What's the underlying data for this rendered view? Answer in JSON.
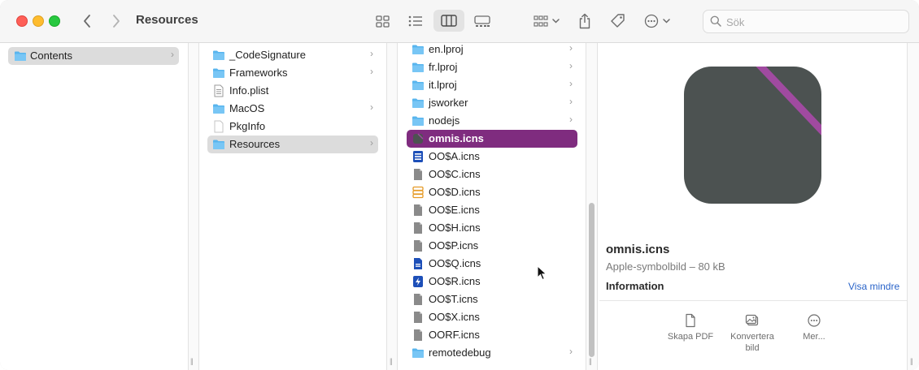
{
  "window": {
    "title": "Resources"
  },
  "toolbar": {
    "back": "back",
    "forward": "forward",
    "views": [
      "icon-view",
      "list-view",
      "column-view",
      "gallery-view"
    ],
    "group": "group",
    "share": "share",
    "tags": "tags",
    "more": "more",
    "search_placeholder": "Sök"
  },
  "columns": [
    {
      "items": [
        {
          "name": "Contents",
          "type": "folder",
          "has_children": true,
          "selected": "gray"
        }
      ]
    },
    {
      "items": [
        {
          "name": "_CodeSignature",
          "type": "folder",
          "has_children": true
        },
        {
          "name": "Frameworks",
          "type": "folder",
          "has_children": true
        },
        {
          "name": "Info.plist",
          "type": "plist",
          "has_children": false
        },
        {
          "name": "MacOS",
          "type": "folder",
          "has_children": true
        },
        {
          "name": "PkgInfo",
          "type": "doc",
          "has_children": false
        },
        {
          "name": "Resources",
          "type": "folder",
          "has_children": true,
          "selected": "gray"
        }
      ]
    },
    {
      "items": [
        {
          "name": "en.lproj",
          "type": "folder",
          "has_children": true
        },
        {
          "name": "fr.lproj",
          "type": "folder",
          "has_children": true
        },
        {
          "name": "it.lproj",
          "type": "folder",
          "has_children": true
        },
        {
          "name": "jsworker",
          "type": "folder",
          "has_children": true
        },
        {
          "name": "nodejs",
          "type": "folder",
          "has_children": true
        },
        {
          "name": "omnis.icns",
          "type": "icns-dark",
          "has_children": false,
          "selected": "purple"
        },
        {
          "name": "OO$A.icns",
          "type": "icns-blue-list",
          "has_children": false
        },
        {
          "name": "OO$C.icns",
          "type": "icns-gray",
          "has_children": false
        },
        {
          "name": "OO$D.icns",
          "type": "icns-orange-db",
          "has_children": false
        },
        {
          "name": "OO$E.icns",
          "type": "icns-gray",
          "has_children": false
        },
        {
          "name": "OO$H.icns",
          "type": "icns-gray",
          "has_children": false
        },
        {
          "name": "OO$P.icns",
          "type": "icns-gray",
          "has_children": false
        },
        {
          "name": "OO$Q.icns",
          "type": "icns-blue-doc",
          "has_children": false
        },
        {
          "name": "OO$R.icns",
          "type": "icns-blue-bolt",
          "has_children": false
        },
        {
          "name": "OO$T.icns",
          "type": "icns-gray",
          "has_children": false
        },
        {
          "name": "OO$X.icns",
          "type": "icns-gray",
          "has_children": false
        },
        {
          "name": "OORF.icns",
          "type": "icns-gray",
          "has_children": false
        },
        {
          "name": "remotedebug",
          "type": "folder",
          "has_children": true
        }
      ]
    }
  ],
  "preview": {
    "name": "omnis.icns",
    "kind": "Apple-symbolbild – 80 kB",
    "section_title": "Information",
    "show_less": "Visa mindre",
    "actions": [
      {
        "label": "Skapa PDF",
        "icon": "pdf-icon"
      },
      {
        "label": "Konvertera bild",
        "icon": "convert-image-icon"
      },
      {
        "label": "Mer...",
        "icon": "more-icon"
      }
    ]
  },
  "colors": {
    "selection_purple": "#7f2c7f",
    "selection_gray": "#dcdcdc",
    "folder_blue": "#58b5ee",
    "icon_stripe": "#a04aa0"
  }
}
